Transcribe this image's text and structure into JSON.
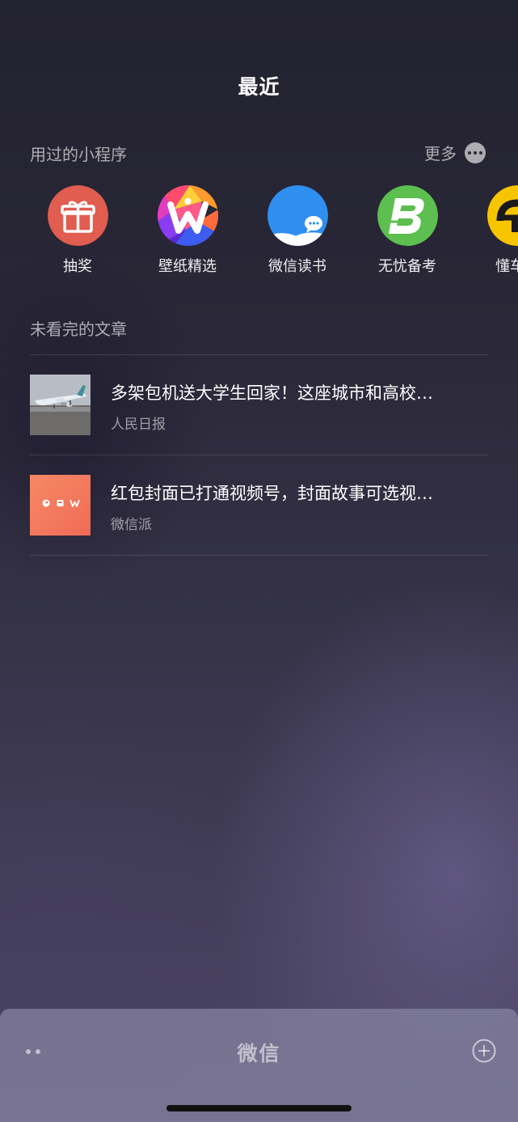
{
  "header": {
    "title": "最近"
  },
  "mini_programs": {
    "section_label": "用过的小程序",
    "more_label": "更多",
    "items": [
      {
        "label": "抽奖",
        "icon": "gift-icon",
        "color": "#e05d4f"
      },
      {
        "label": "壁纸精选",
        "icon": "wallpaper-w-icon",
        "color": "#ff5a8a"
      },
      {
        "label": "微信读书",
        "icon": "book-chat-icon",
        "color": "#2f8ff0"
      },
      {
        "label": "无忧备考",
        "icon": "letter-b-icon",
        "color": "#5cbf4f"
      },
      {
        "label": "懂车帝",
        "icon": "car-logo-icon",
        "color": "#f7c400"
      }
    ]
  },
  "articles": {
    "section_label": "未看完的文章",
    "items": [
      {
        "title": "多架包机送大学生回家！这座城市和高校…",
        "source": "人民日报",
        "thumb_icon": "airplane-photo-thumbnail"
      },
      {
        "title": "红包封面已打通视频号，封面故事可选视…",
        "source": "微信派",
        "thumb_icon": "red-packet-cover-thumbnail",
        "thumb_color": "#f47b5d"
      }
    ]
  },
  "bottom_bar": {
    "title": "微信"
  }
}
